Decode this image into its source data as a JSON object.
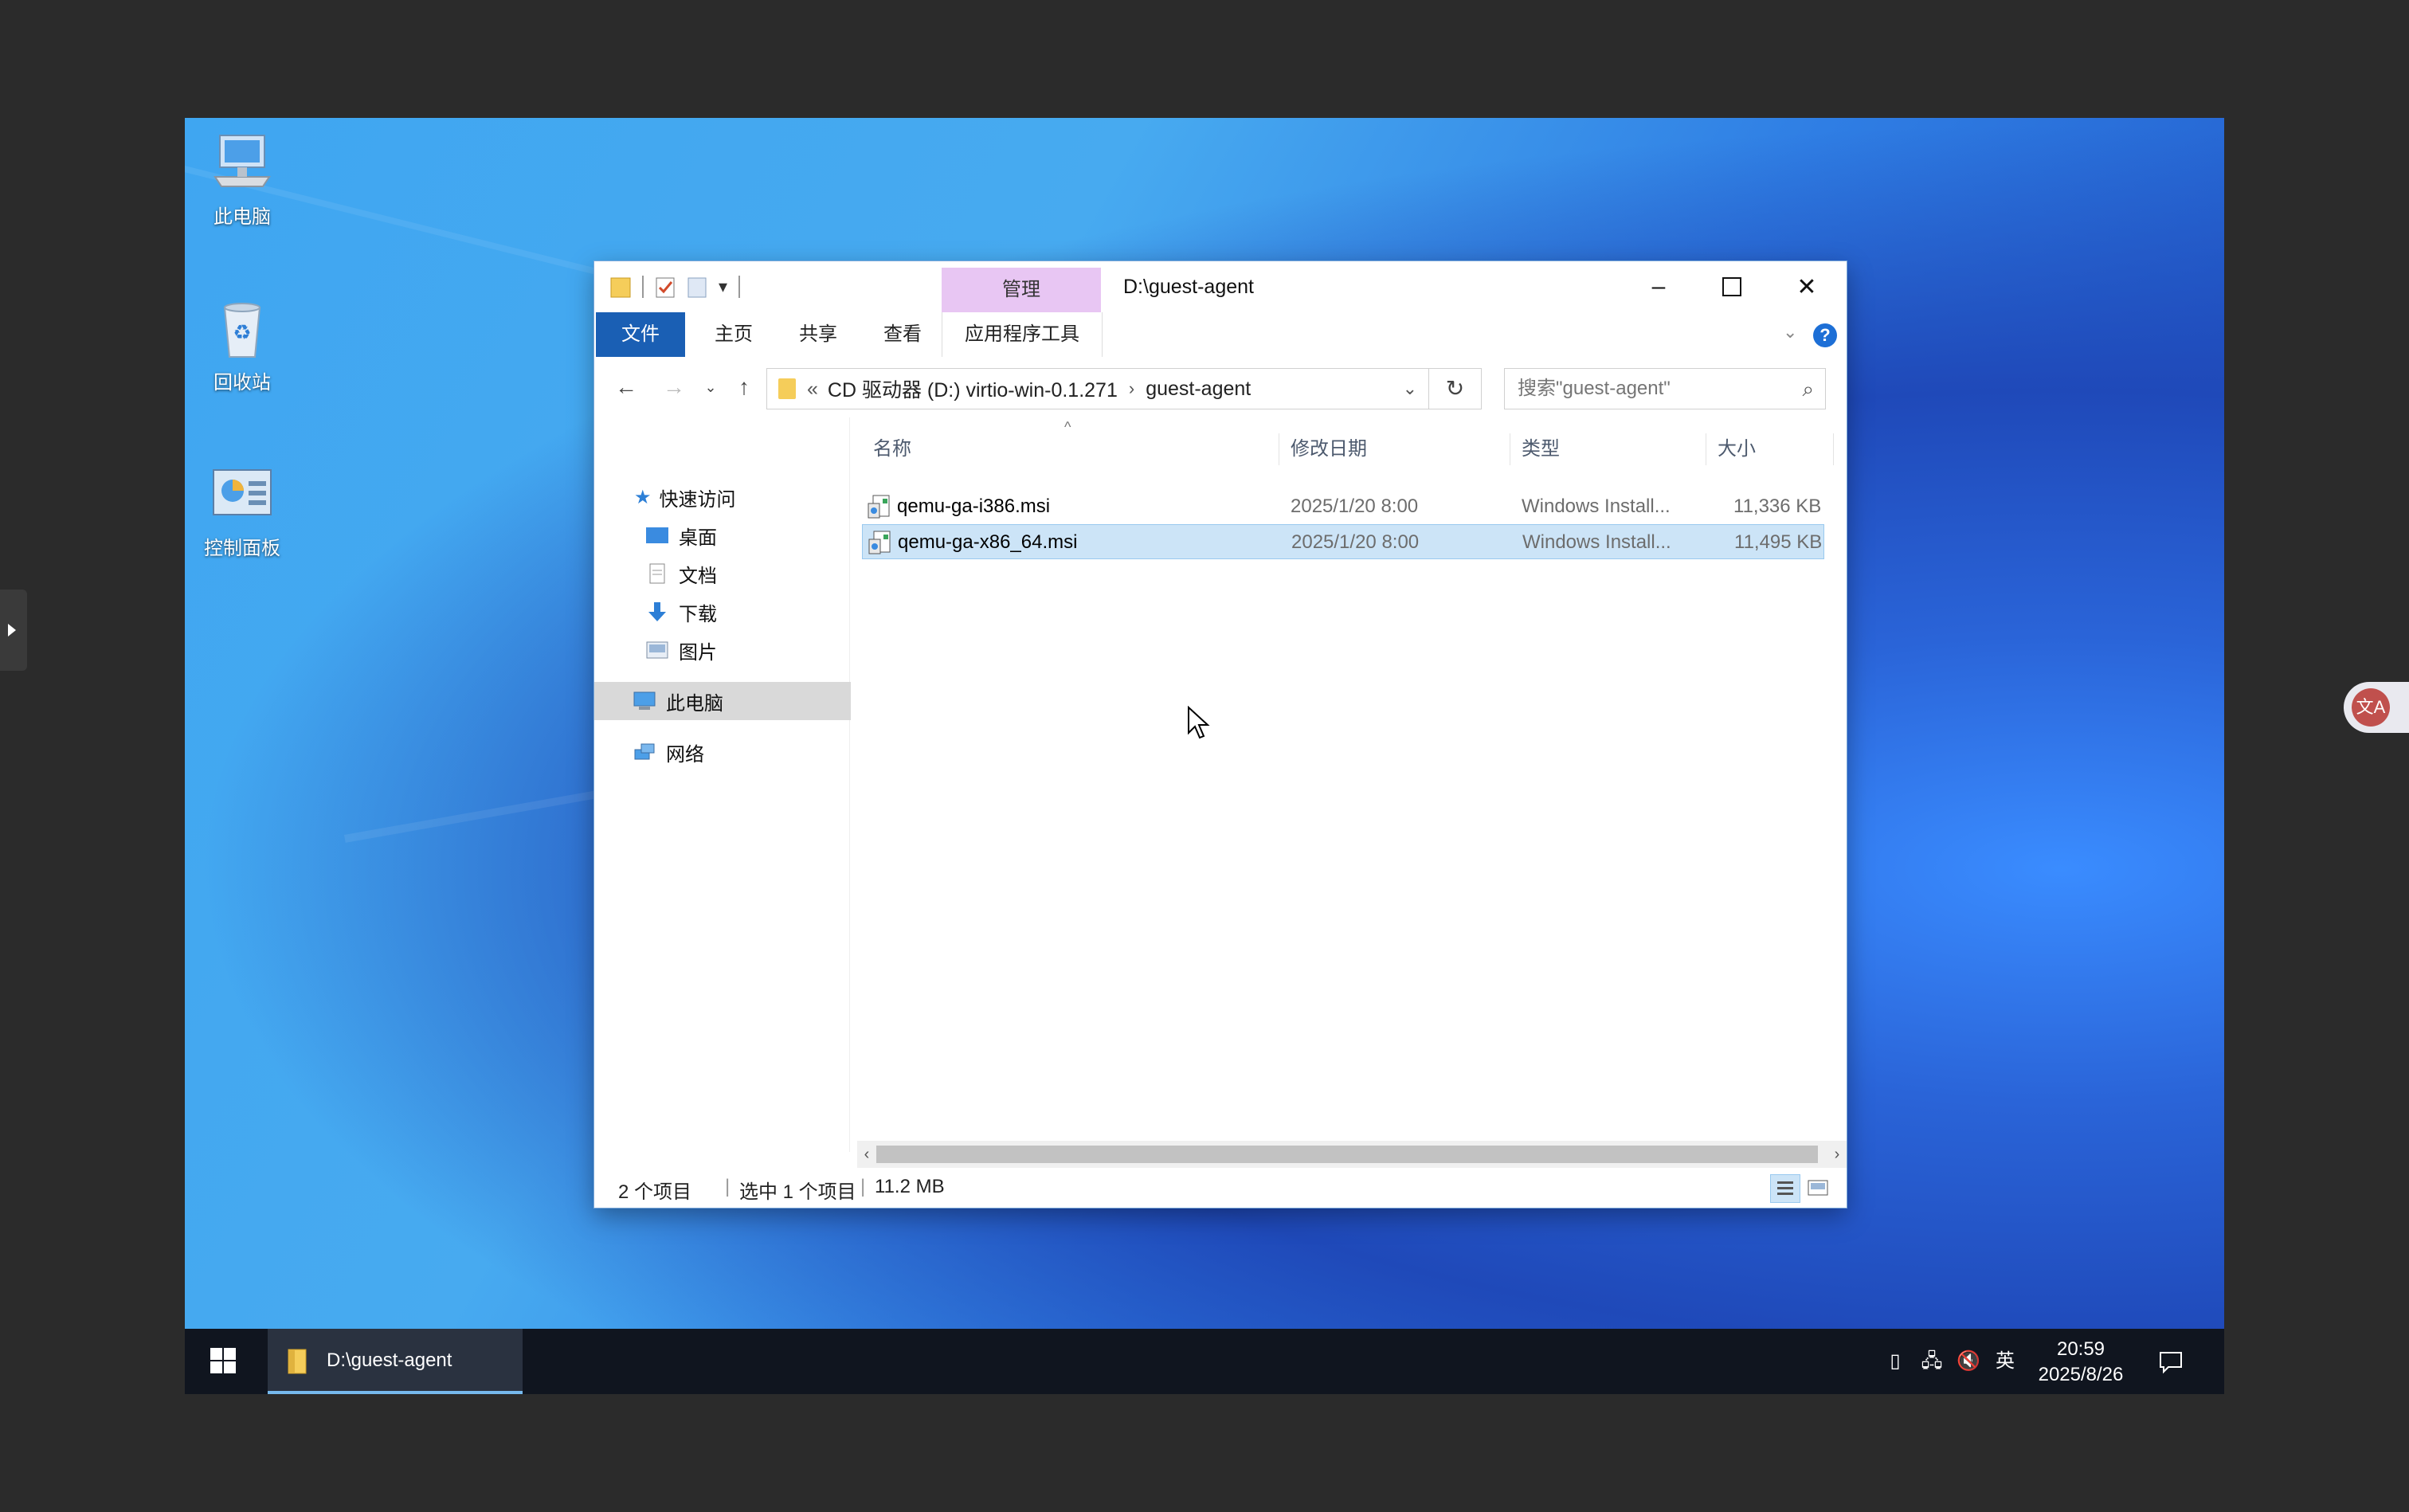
{
  "desktop": {
    "icons": [
      {
        "label": "此电脑",
        "icon": "computer-icon"
      },
      {
        "label": "回收站",
        "icon": "recycle-bin-icon"
      },
      {
        "label": "控制面板",
        "icon": "control-panel-icon"
      }
    ]
  },
  "window": {
    "title": "D:\\guest-agent",
    "contextual_tab_header": "管理",
    "tabs": [
      "文件",
      "主页",
      "共享",
      "查看",
      "应用程序工具"
    ],
    "breadcrumb": {
      "overflow": "«",
      "parts": [
        "CD 驱动器 (D:) virtio-win-0.1.271",
        "guest-agent"
      ]
    },
    "search_placeholder": "搜索\"guest-agent\"",
    "nav": {
      "quick_access": "快速访问",
      "pinned": [
        "桌面",
        "文档",
        "下载",
        "图片"
      ],
      "this_pc": "此电脑",
      "network": "网络"
    },
    "columns": [
      "名称",
      "修改日期",
      "类型",
      "大小"
    ],
    "files": [
      {
        "name": "qemu-ga-i386.msi",
        "modified": "2025/1/20 8:00",
        "type": "Windows Install...",
        "size": "11,336 KB",
        "selected": false
      },
      {
        "name": "qemu-ga-x86_64.msi",
        "modified": "2025/1/20 8:00",
        "type": "Windows Install...",
        "size": "11,495 KB",
        "selected": true
      }
    ],
    "status": {
      "count": "2 个项目",
      "selection": "选中 1 个项目",
      "size": "11.2 MB"
    }
  },
  "taskbar": {
    "active_task": "D:\\guest-agent",
    "ime": "英",
    "time": "20:59",
    "date": "2025/8/26"
  },
  "colors": {
    "accent": "#1a5fb4",
    "selection": "#cce4f7",
    "manage_tab": "#e8c6f3",
    "taskbar": "#10151f"
  }
}
